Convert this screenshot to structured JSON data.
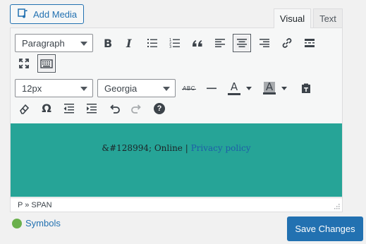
{
  "media": {
    "add_media_label": "Add Media"
  },
  "tabs": [
    {
      "label": "Visual",
      "active": true
    },
    {
      "label": "Text",
      "active": false
    }
  ],
  "toolbar": {
    "format_select": "Paragraph",
    "font_size_select": "12px",
    "font_family_select": "Georgia",
    "strikethrough_glyph": "ABC",
    "text_color_glyph": "A",
    "background_color_glyph": "A",
    "special_char_glyph": "Ω",
    "help_glyph": "?"
  },
  "content": {
    "text": "&#128994; Online | ",
    "link_text": "Privacy policy",
    "background_color": "#26a497"
  },
  "status": {
    "path": "P » SPAN"
  },
  "symbols": {
    "label": "Symbols",
    "dot_color": "#6ab04c"
  },
  "actions": {
    "save_label": "Save Changes",
    "accent": "#2271b1"
  }
}
